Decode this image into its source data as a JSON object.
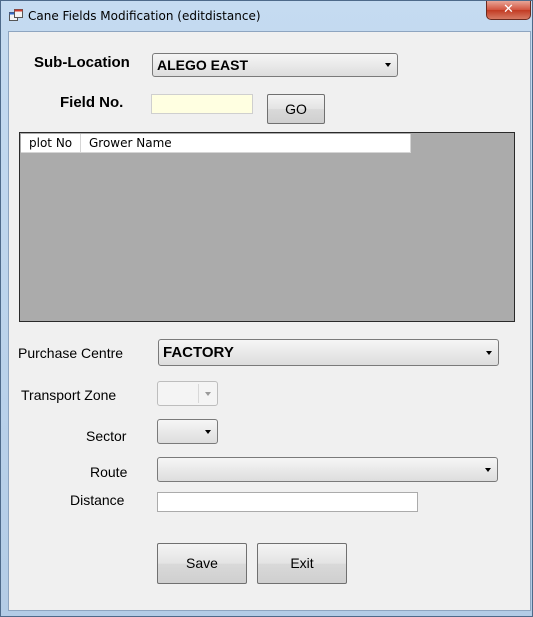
{
  "window": {
    "title": "Cane Fields Modification (editdistance)",
    "close_label": "✕"
  },
  "form": {
    "sub_location_label": "Sub-Location",
    "sub_location_value": "ALEGO EAST",
    "field_no_label": "Field No.",
    "field_no_value": "",
    "go_label": "GO",
    "grid_columns": [
      "plot No",
      "Grower Name"
    ],
    "purchase_centre_label": "Purchase Centre",
    "purchase_centre_value": "FACTORY",
    "transport_zone_label": "Transport Zone",
    "transport_zone_value": "",
    "sector_label": "Sector",
    "sector_value": "",
    "route_label": "Route",
    "route_value": "",
    "distance_label": "Distance",
    "distance_value": "",
    "save_label": "Save",
    "exit_label": "Exit"
  },
  "colors": {
    "field_no_highlight": "#ffffe1",
    "grid_background": "#ababab"
  }
}
